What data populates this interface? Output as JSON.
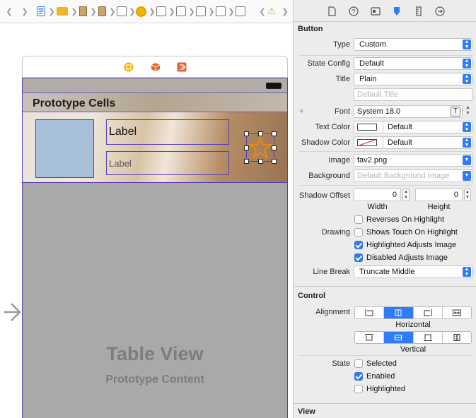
{
  "canvas": {
    "scene_title": "Prototype Cells",
    "cell": {
      "label1": "Label",
      "label2": "Label"
    },
    "table_view_title": "Table View",
    "table_view_subtitle": "Prototype Content"
  },
  "inspector": {
    "button_section": {
      "title": "Button",
      "type_label": "Type",
      "type_value": "Custom",
      "state_config_label": "State Config",
      "state_config_value": "Default",
      "title_label": "Title",
      "title_value": "Plain",
      "title_text_placeholder": "Default Title",
      "font_label": "Font",
      "font_value": "System 18.0",
      "text_color_label": "Text Color",
      "text_color_value": "Default",
      "shadow_color_label": "Shadow Color",
      "shadow_color_value": "Default",
      "image_label": "Image",
      "image_value": "fav2.png",
      "background_label": "Background",
      "background_placeholder": "Default Background Image",
      "shadow_offset_label": "Shadow Offset",
      "shadow_offset_width": "0",
      "shadow_offset_height": "0",
      "width_caption": "Width",
      "height_caption": "Height",
      "drawing_label": "Drawing",
      "drawing_options": [
        {
          "label": "Reverses On Highlight",
          "checked": false
        },
        {
          "label": "Shows Touch On Highlight",
          "checked": false
        },
        {
          "label": "Highlighted Adjusts Image",
          "checked": true
        },
        {
          "label": "Disabled Adjusts Image",
          "checked": true
        }
      ],
      "line_break_label": "Line Break",
      "line_break_value": "Truncate Middle"
    },
    "control_section": {
      "title": "Control",
      "alignment_label": "Alignment",
      "horizontal_caption": "Horizontal",
      "vertical_caption": "Vertical",
      "horizontal_selected_index": 1,
      "vertical_selected_index": 1,
      "state_label": "State",
      "state_options": [
        {
          "label": "Selected",
          "checked": false
        },
        {
          "label": "Enabled",
          "checked": true
        },
        {
          "label": "Highlighted",
          "checked": false
        }
      ]
    },
    "view_section": {
      "title": "View"
    }
  },
  "colors": {
    "accent": "#2f7cf6",
    "selection_outline": "#5a3db8",
    "star": "#e58a17"
  }
}
